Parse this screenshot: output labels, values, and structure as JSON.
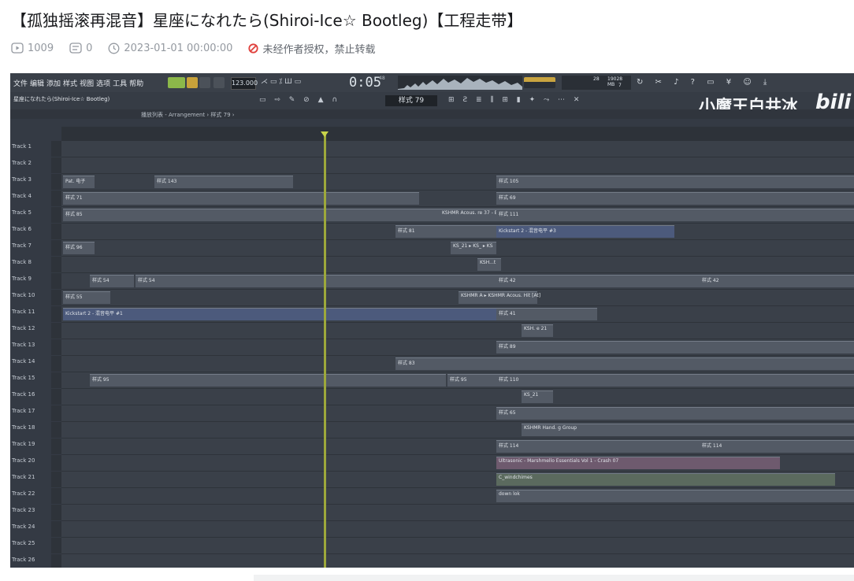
{
  "video_title": "【孤独摇滚再混音】星座になれたら(Shiroi-Ice☆ Bootleg)【工程走带】",
  "stats": {
    "views": "1009",
    "danmaku": "0",
    "publish_time": "2023-01-01 00:00:00",
    "copyright_notice": "未经作者授权，禁止转载"
  },
  "daw": {
    "menu": [
      "文件",
      "编辑",
      "添加",
      "样式",
      "视图",
      "选项",
      "工具",
      "帮助"
    ],
    "tempo": "123.000",
    "time": "0:05",
    "time_sub": "48",
    "window_title": "星座になれたら(Shiroi-Ice☆ Bootleg)",
    "pattern_selector": "样式 79",
    "breadcrumb": "播放列表 - Arrangement › 样式 79 ›",
    "cpu_mem": "19028 MB",
    "cpu_cores": "7",
    "cpu_val": "28",
    "watermark": "小魔王白井冰",
    "brand": "bili",
    "tracks": [
      "Track 1",
      "Track 2",
      "Track 3",
      "Track 4",
      "Track 5",
      "Track 6",
      "Track 7",
      "Track 8",
      "Track 9",
      "Track 10",
      "Track 11",
      "Track 12",
      "Track 13",
      "Track 14",
      "Track 15",
      "Track 16",
      "Track 17",
      "Track 18",
      "Track 19",
      "Track 20",
      "Track 21",
      "Track 22",
      "Track 23",
      "Track 24",
      "Track 25",
      "Track 26"
    ],
    "clips": {
      "t3a": "Pat. 电子",
      "t3b": "样式 143",
      "t3c": "样式 105",
      "t4a": "样式 71",
      "t4b": "样式 69",
      "t5a": "样式 85",
      "t5b": "KSHMR Acous. re 37 - Bb",
      "t5c": "样式 111",
      "t6a": "样式 81",
      "t6b": "Kickstart 2 - 混音电平 #3",
      "t7a": "样式 96",
      "t7b": "KS_21 ▸ KS_ ▸ KS",
      "t8a": "KSH...t",
      "t9a": "样式 54",
      "t9b": "样式 54",
      "t9c": "样式 42",
      "t9d": "样式 42",
      "t10a": "样式 55",
      "t10b": "KSHMR A ▸ KSHMR Acous. Hit [At]",
      "t11a": "Kickstart 2 - 混音电平 #1",
      "t11b": "样式 41",
      "t12": "KSH. e 21",
      "t13": "样式 89",
      "t14": "样式 83",
      "t15a": "样式 95",
      "t15b": "样式 95",
      "t15c": "样式 110",
      "t16": "KS_21",
      "t17": "样式 65",
      "t18": "KSHMR Hand. g Group",
      "t19a": "样式 114",
      "t19b": "样式 114",
      "t20": "Ultrasonic - Marshmello Essentials Vol 1 - Crash 07",
      "t21": "C_windchimes",
      "t22": "down lok"
    }
  }
}
